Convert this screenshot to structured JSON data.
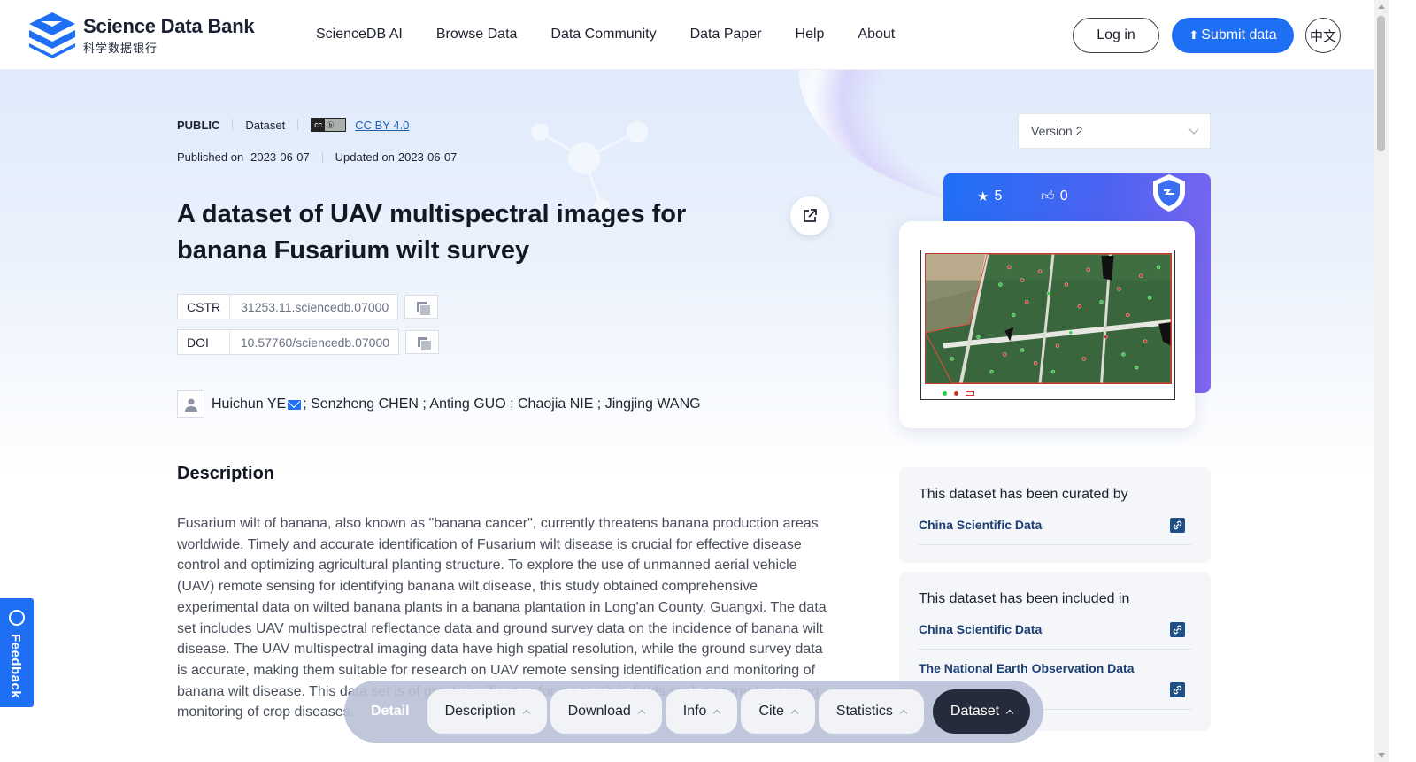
{
  "header": {
    "logo_en": "Science Data Bank",
    "logo_cn": "科学数据银行",
    "nav": [
      "ScienceDB AI",
      "Browse Data",
      "Data Community",
      "Data Paper",
      "Help",
      "About"
    ],
    "login_label": "Log in",
    "submit_label": "Submit data",
    "lang_label": "中文"
  },
  "meta": {
    "access": "PUBLIC",
    "type": "Dataset",
    "license": "CC BY 4.0",
    "published_label": "Published on",
    "published_date": "2023-06-07",
    "updated_label": "Updated on",
    "updated_date": "2023-06-07"
  },
  "dataset": {
    "title": "A dataset of UAV multispectral images for banana Fusarium wilt survey",
    "cstr_label": "CSTR",
    "cstr_value": "31253.11.sciencedb.07000",
    "doi_label": "DOI",
    "doi_value": "10.57760/sciencedb.07000",
    "first_author": "Huichun YE",
    "other_authors": "; Senzheng CHEN ; Anting GUO ; Chaojia NIE ; Jingjing WANG"
  },
  "description": {
    "heading": "Description",
    "text": "Fusarium wilt of banana, also known as \"banana cancer\", currently threatens banana production areas worldwide. Timely and accurate identification of Fusarium wilt disease is crucial for effective disease control and optimizing agricultural planting structure. To explore the use of unmanned aerial vehicle (UAV) remote sensing for identifying banana wilt disease, this study obtained comprehensive experimental data on wilted banana plants in a banana plantation in Long'an County, Guangxi. The data set includes UAV multispectral reflectance data and ground survey data on the incidence of banana wilt disease. The UAV multispectral imaging data have high spatial resolution, while the ground survey data is accurate, making them suitable for research on UAV remote sensing identification and monitoring of banana wilt disease. This data set is of great significance for research in fields such as remote sensing monitoring of crop diseases."
  },
  "sidebar": {
    "version": "Version 2",
    "stars": "5",
    "likes": "0",
    "curated_heading": "This dataset has been curated by",
    "curated_by": "China Scientific Data",
    "included_heading": "This dataset has been included in",
    "included_in": [
      "China Scientific Data",
      "The National Earth Observation Data"
    ]
  },
  "bottom_nav": {
    "detail": "Detail",
    "items": [
      "Description",
      "Download",
      "Info",
      "Cite",
      "Statistics",
      "Dataset"
    ]
  },
  "feedback_label": "Feedback",
  "colors": {
    "primary": "#1f6ff5",
    "link_dark": "#1b3f73",
    "nav_active": "#252b3a"
  }
}
